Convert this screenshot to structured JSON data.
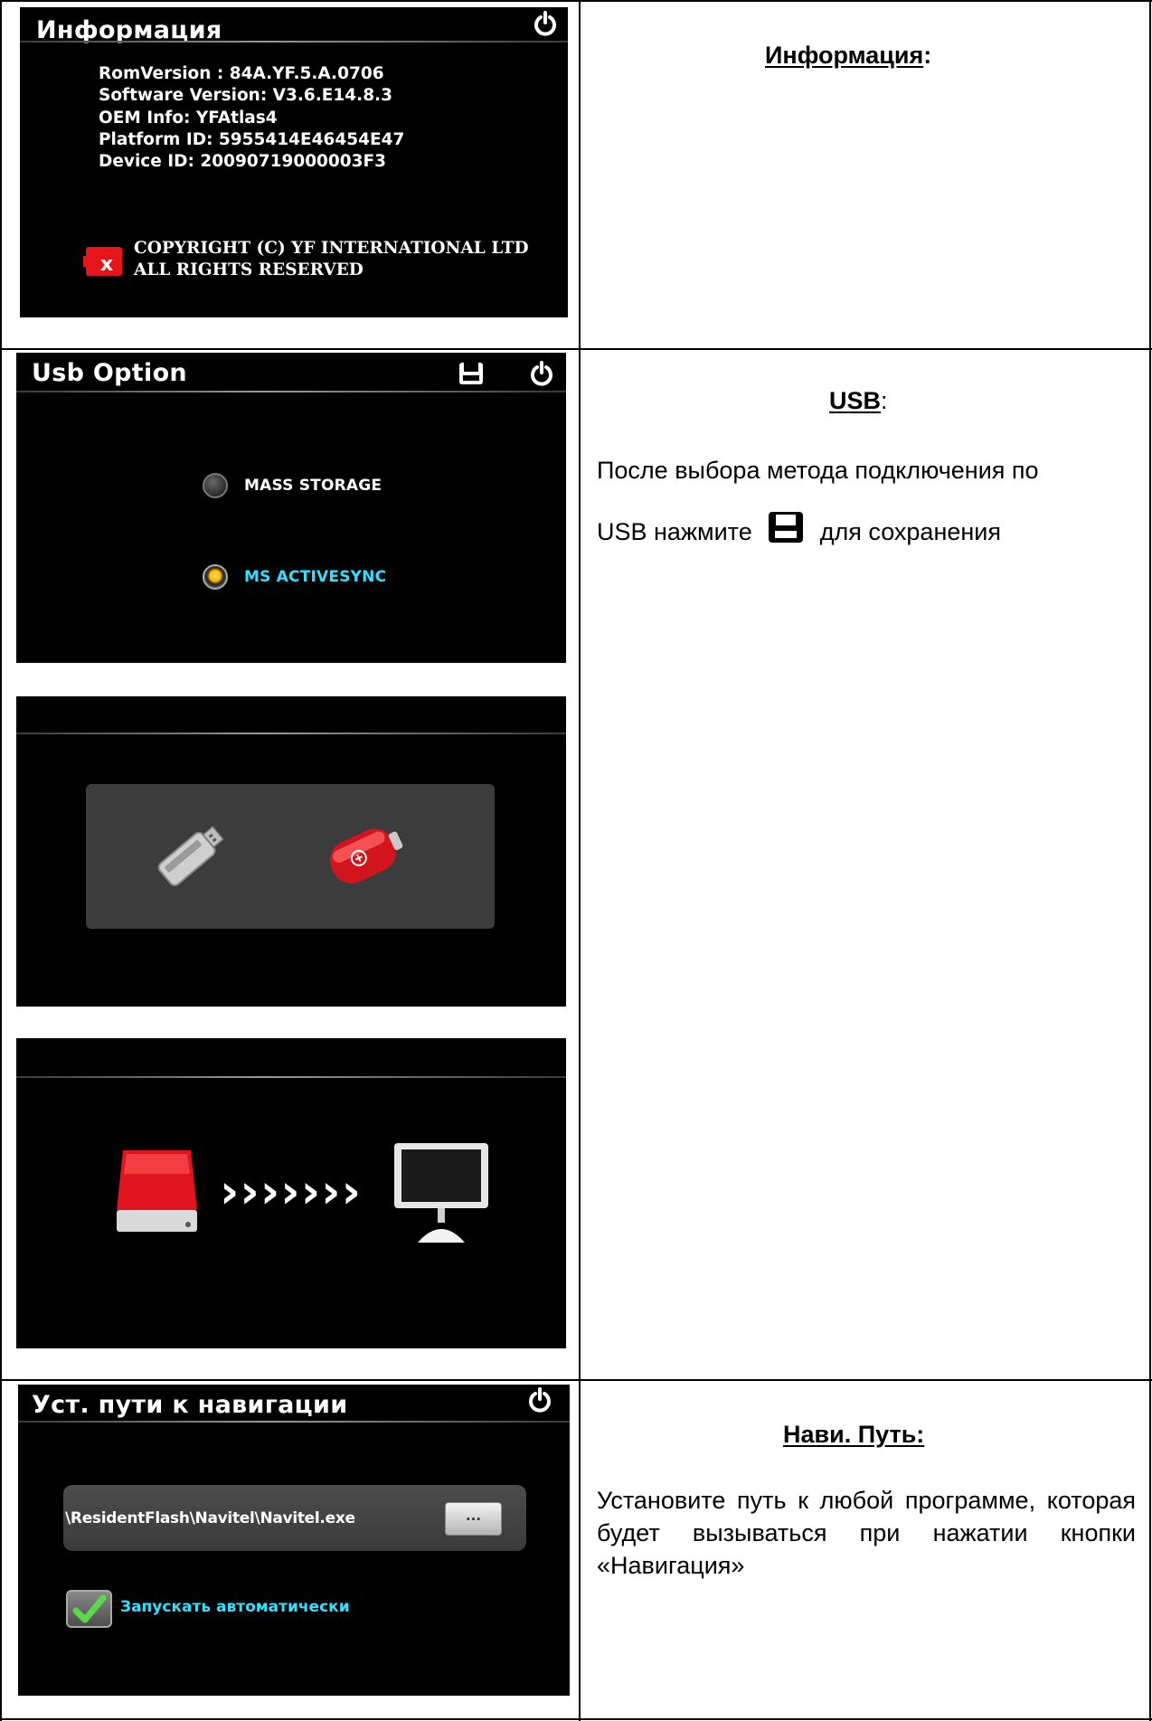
{
  "info_screen": {
    "title": "Информация",
    "lines": [
      "RomVersion : 84A.YF.5.A.0706",
      "Software Version: V3.6.E14.8.3",
      "OEM Info: YFAtlas4",
      "Platform ID: 5955414E46454E47",
      "Device ID: 20090719000003F3"
    ],
    "copyright_line1": "COPYRIGHT (C) YF INTERNATIONAL LTD",
    "copyright_line2": "ALL RIGHTS RESERVED"
  },
  "info_description": {
    "heading": "Информация",
    "heading_suffix": ":"
  },
  "usb_screen": {
    "title": "Usb Option",
    "options": [
      {
        "label": "MASS STORAGE",
        "selected": false,
        "color": "#ffffff"
      },
      {
        "label": "MS ACTIVESYNC",
        "selected": true,
        "color": "#2fe0ff"
      }
    ]
  },
  "usb_transfer": {
    "arrows": "›››››››"
  },
  "usb_description": {
    "heading": "USB",
    "heading_suffix": ":",
    "text_line1": "После выбора метода подключения по",
    "text_line2_before": "USB нажмите",
    "text_line2_after": "для сохранения",
    "icon": "save-icon"
  },
  "nav_screen": {
    "title": "Уст. пути к навигации",
    "path": "\\ResidentFlash\\Navitel\\Navitel.exe",
    "browse_label": "...",
    "autostart_label": "Запускать автоматически",
    "autostart_checked": true
  },
  "nav_description": {
    "heading": "Нави. Путь:",
    "text": "Установите путь к любой программе, которая будет вызываться при нажатии кнопки «Навигация»"
  },
  "colors": {
    "screen_bg": "#000000",
    "accent_cyan": "#2fe0ff",
    "logo_red": "#e8141c"
  }
}
